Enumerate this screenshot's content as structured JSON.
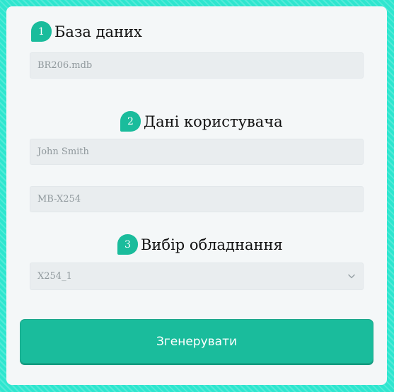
{
  "sections": [
    {
      "step": "1",
      "title": "База даних"
    },
    {
      "step": "2",
      "title": "Дані користувача"
    },
    {
      "step": "3",
      "title": "Вибір обладнання"
    }
  ],
  "database": {
    "value": "BR206.mdb"
  },
  "user": {
    "name_value": "John Smith",
    "model_value": "MB-X254"
  },
  "equipment": {
    "selected": "X254_1"
  },
  "generate_button": {
    "label": "Згенерувати"
  },
  "colors": {
    "accent": "#1abc9c",
    "background": "#2ee6cf",
    "card": "#f4f7f8",
    "field": "#e9edef"
  },
  "icons": {
    "select_arrow": "chevron-down-icon"
  }
}
